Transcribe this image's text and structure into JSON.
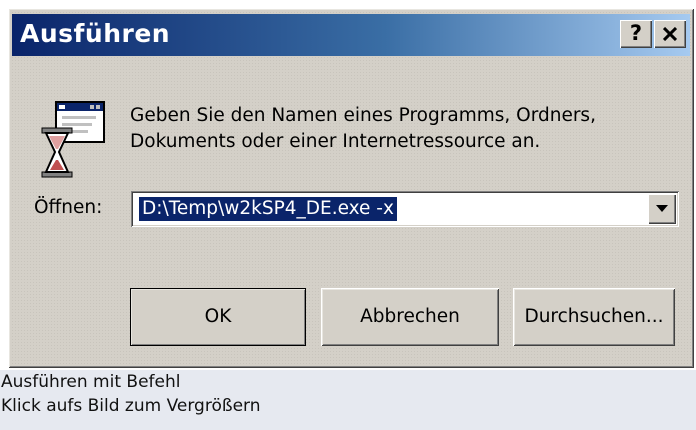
{
  "dialog": {
    "title": "Ausführen",
    "help_button": "?",
    "close_button": "✕",
    "message_line1": "Geben Sie den Namen eines Programms, Ordners,",
    "message_line2": "Dokuments oder einer Internetressource an.",
    "open_label": "Öffnen:",
    "open_value": "D:\\Temp\\w2kSP4_DE.exe -x",
    "ok_label": "OK",
    "cancel_label": "Abbrechen",
    "browse_label": "Durchsuchen..."
  },
  "caption": {
    "line1": "Ausführen mit Befehl",
    "line2": "Klick aufs Bild zum Vergrößern"
  },
  "icons": [
    "run-program-icon",
    "dropdown-arrow-icon",
    "help-icon",
    "close-icon"
  ],
  "colors": {
    "titlebar_start": "#0a246a",
    "titlebar_end": "#a6caf0",
    "dialog_face": "#d4d0c8",
    "selection": "#0a246a",
    "caption_bg": "#e6e9f0"
  }
}
